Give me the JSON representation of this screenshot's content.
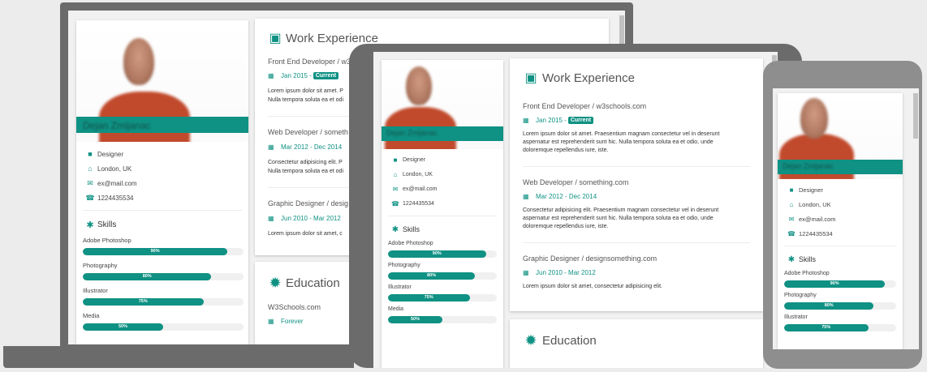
{
  "profile": {
    "name": "Dejan Zmijanac",
    "job": "Designer",
    "city": "London, UK",
    "email": "ex@mail.com",
    "phone": "1224435534"
  },
  "skills": {
    "title": "Skills",
    "items": [
      {
        "name": "Adobe Photoshop",
        "percent": 90,
        "label": "90%"
      },
      {
        "name": "Photography",
        "percent": 80,
        "label": "80%"
      },
      {
        "name": "Illustrator",
        "percent": 75,
        "label": "75%"
      },
      {
        "name": "Media",
        "percent": 50,
        "label": "50%"
      }
    ]
  },
  "work": {
    "title": "Work Experience",
    "jobs": [
      {
        "title": "Front End Developer / w3schools.com",
        "date": "Jan 2015 - ",
        "badge": "Current",
        "text": "Lorem ipsum dolor sit amet. Praesentium magnam consectetur vel in deserunt aspernatur est reprehenderit sunt hic. Nulla tempora soluta ea et odio, unde doloremque repellendus iure, iste."
      },
      {
        "title": "Web Developer / something.com",
        "date": "Mar 2012 - Dec 2014",
        "badge": "",
        "text": "Consectetur adipisicing elit. Praesentium magnam consectetur vel in deserunt aspernatur est reprehenderit sunt hic. Nulla tempora soluta ea et odio, unde doloremque repellendus iure, iste."
      },
      {
        "title": "Graphic Designer / designsomething.com",
        "date": "Jun 2010 - Mar 2012",
        "badge": "",
        "text": "Lorem ipsum dolor sit amet, consectetur adipisicing elit."
      }
    ]
  },
  "education": {
    "title": "Education",
    "school": "W3Schools.com",
    "date": "Forever"
  },
  "laptop": {
    "job0_title": "Front End Developer / w3",
    "job0_text1": "Lorem ipsum dolor sit amet. P",
    "job0_text2": "Nulla tempora soluta ea et odi",
    "job1_title": "Web Developer / someth",
    "job1_text1": "Consectetur adipisicing elit. P",
    "job1_text2": "Nulla tempora soluta ea et odi",
    "job2_title": "Graphic Designer / desig",
    "job2_text1": "Lorem ipsum dolor sit amet, c"
  },
  "tablet": {
    "job0_text1": "Lorem ipsum dolor sit amet. Praesentium magnam consectetur vel in deserunt",
    "job0_text2": "aspernatur est reprehenderit sunt hic. Nulla tempora soluta ea et odio, unde",
    "job0_text3": "doloremque repellendus iure, iste.",
    "job1_text1": "Consectetur adipisicing elit. Praesentium magnam consectetur vel in deserunt",
    "job1_text2": "aspernatur est reprehenderit sunt hic. Nulla tempora soluta ea et odio, unde",
    "job1_text3": "doloremque repellendus iure, iste."
  },
  "icons": {
    "job": "briefcase-icon",
    "city": "home-icon",
    "email": "envelope-icon",
    "phone": "phone-icon",
    "skills": "asterisk-icon",
    "work": "suitcase-icon",
    "education": "certificate-icon",
    "date": "calendar-icon"
  },
  "colors": {
    "accent": "#0f9183",
    "device_frame": "#6b6b6b",
    "phone_frame": "#8e8e8e"
  }
}
